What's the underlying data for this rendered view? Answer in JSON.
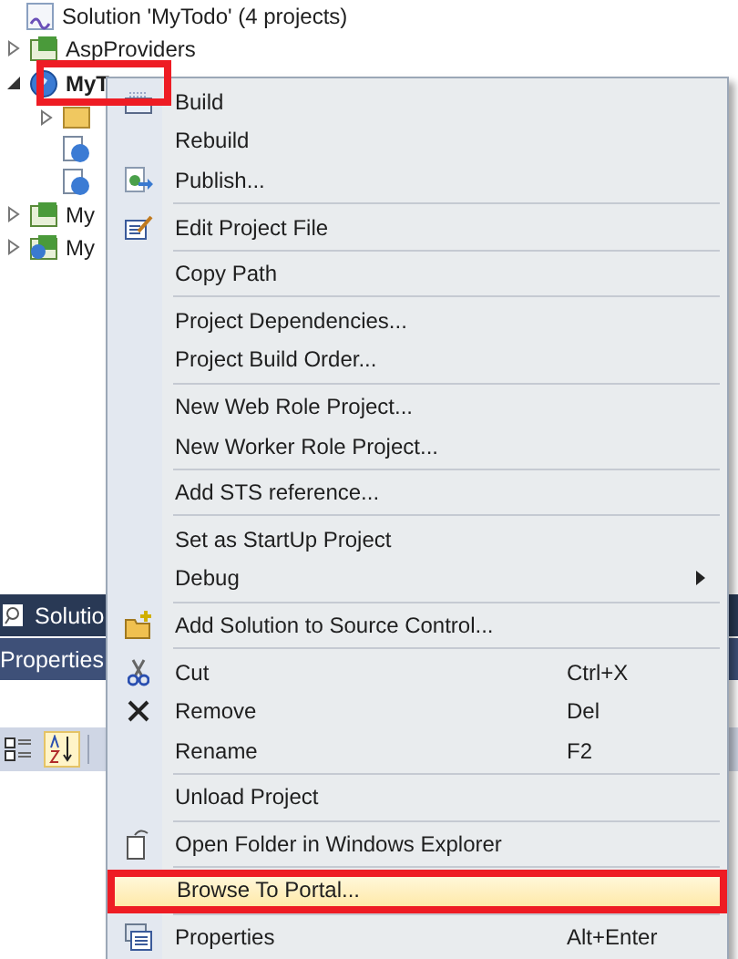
{
  "solution_explorer": {
    "root": {
      "label": "Solution 'MyTodo' (4 projects)"
    },
    "items": [
      {
        "label": "AspProviders",
        "kind": "csharp",
        "expanded": false,
        "selected": false
      },
      {
        "label": "MyT",
        "kind": "web",
        "expanded": true,
        "selected": true,
        "children": [
          {
            "kind": "folder",
            "expanded": false
          },
          {
            "kind": "web-file"
          },
          {
            "kind": "web-file"
          }
        ]
      },
      {
        "label": "My",
        "kind": "csharp",
        "expanded": false,
        "selected": false
      },
      {
        "label": "My",
        "kind": "csharp-web",
        "expanded": false,
        "selected": false
      }
    ]
  },
  "search_tab": {
    "label": "Solutio"
  },
  "properties_panel": {
    "title": "Properties",
    "sort_buttons": [
      {
        "kind": "categorized",
        "selected": false
      },
      {
        "kind": "alphabetical",
        "selected": true
      }
    ]
  },
  "context_menu": {
    "groups": [
      [
        {
          "label": "Build",
          "kind": "build",
          "selected": false
        },
        {
          "label": "Rebuild",
          "selected": false
        },
        {
          "label": "Publish...",
          "kind": "publish",
          "selected": false
        }
      ],
      [
        {
          "label": "Edit Project File",
          "kind": "edit",
          "selected": false
        }
      ],
      [
        {
          "label": "Copy Path",
          "selected": false
        }
      ],
      [
        {
          "label": "Project Dependencies...",
          "selected": false
        },
        {
          "label": "Project Build Order...",
          "selected": false
        }
      ],
      [
        {
          "label": "New Web Role Project...",
          "selected": false
        },
        {
          "label": "New Worker Role Project...",
          "selected": false
        }
      ],
      [
        {
          "label": "Add STS reference...",
          "selected": false
        }
      ],
      [
        {
          "label": "Set as StartUp Project",
          "selected": false
        },
        {
          "label": "Debug",
          "submenu": true,
          "selected": false
        }
      ],
      [
        {
          "label": "Add Solution to Source Control...",
          "kind": "source-control",
          "selected": false
        }
      ],
      [
        {
          "label": "Cut",
          "kind": "cut",
          "shortcut": "Ctrl+X",
          "selected": false
        },
        {
          "label": "Remove",
          "kind": "remove",
          "shortcut": "Del",
          "selected": false
        },
        {
          "label": "Rename",
          "shortcut": "F2",
          "selected": false
        }
      ],
      [
        {
          "label": "Unload Project",
          "selected": false
        }
      ],
      [
        {
          "label": "Open Folder in Windows Explorer",
          "kind": "open-folder",
          "selected": false
        }
      ],
      [
        {
          "label": "Browse To Portal...",
          "selected": true,
          "marked": true
        }
      ],
      [
        {
          "label": "Properties",
          "kind": "properties",
          "shortcut": "Alt+Enter",
          "selected": false
        }
      ]
    ]
  }
}
